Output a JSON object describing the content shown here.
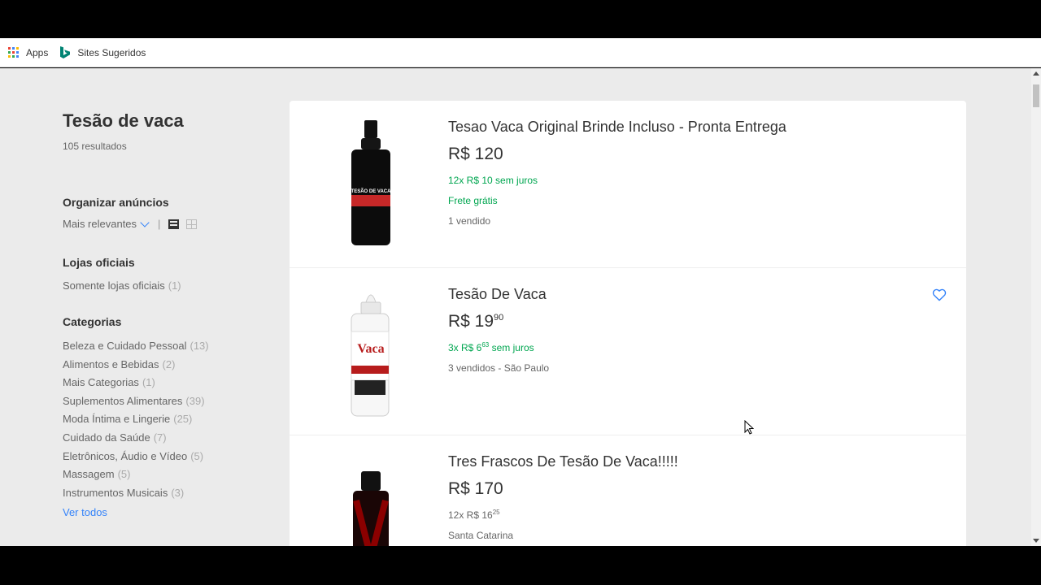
{
  "browser": {
    "bookmarks": [
      {
        "label": "Apps",
        "icon": "apps-grid-icon"
      },
      {
        "label": "Sites Sugeridos",
        "icon": "bing-icon"
      }
    ]
  },
  "sidebar": {
    "search_title": "Tesão de vaca",
    "results_count": "105 resultados",
    "sort": {
      "title": "Organizar anúncios",
      "selected": "Mais relevantes",
      "separator": "|",
      "view_icons": [
        "list-view-icon",
        "grid-view-icon"
      ]
    },
    "official_stores": {
      "title": "Lojas oficiais",
      "option": "Somente lojas oficiais",
      "count": "(1)"
    },
    "categories": {
      "title": "Categorias",
      "items": [
        {
          "label": "Beleza e Cuidado Pessoal",
          "count": "(13)"
        },
        {
          "label": "Alimentos e Bebidas",
          "count": "(2)"
        },
        {
          "label": "Mais Categorias",
          "count": "(1)"
        },
        {
          "label": "Suplementos Alimentares",
          "count": "(39)"
        },
        {
          "label": "Moda Íntima e Lingerie",
          "count": "(25)"
        },
        {
          "label": "Cuidado da Saúde",
          "count": "(7)"
        },
        {
          "label": "Eletrônicos, Áudio e Vídeo",
          "count": "(5)"
        },
        {
          "label": "Massagem",
          "count": "(5)"
        },
        {
          "label": "Instrumentos Musicais",
          "count": "(3)"
        }
      ],
      "see_all": "Ver todos"
    }
  },
  "results": [
    {
      "title": "Tesao Vaca Original Brinde Incluso - Pronta Entrega",
      "price_main": "R$ 120",
      "price_cents": "",
      "install_prefix": "12x R$ 10",
      "install_cents": "",
      "install_suffix": " sem juros",
      "shipping": "Frete grátis",
      "sold": "1 vendido",
      "label_on_bottle": "TESÃO DE VACA"
    },
    {
      "title": "Tesão De Vaca",
      "price_main": "R$ 19",
      "price_cents": "90",
      "install_prefix": "3x R$ 6",
      "install_cents": "63",
      "install_suffix": " sem juros",
      "shipping": "",
      "sold": "3 vendidos - São Paulo",
      "label_on_bottle": "Vaca"
    },
    {
      "title": "Tres Frascos De Tesão De Vaca!!!!!",
      "price_main": "R$ 170",
      "price_cents": "",
      "install_prefix": "12x R$ 16",
      "install_cents": "25",
      "install_suffix": "",
      "shipping": "",
      "sold": "Santa Catarina",
      "label_on_bottle": ""
    }
  ],
  "colors": {
    "accent_blue": "#3483fa",
    "green": "#00a650",
    "page_bg": "#ebebeb"
  }
}
